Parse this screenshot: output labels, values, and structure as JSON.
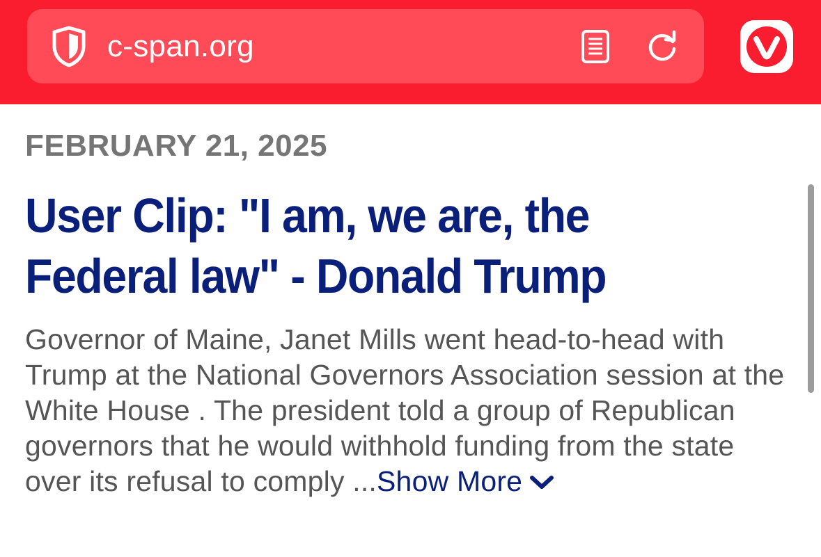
{
  "browser": {
    "url": "c-span.org",
    "accent_color": "#fa1c2f",
    "icons": [
      "shield-icon",
      "reader-mode-icon",
      "reload-icon",
      "vivaldi-logo"
    ]
  },
  "article": {
    "date": "FEBRUARY 21, 2025",
    "title": "User Clip: \"I am, we are, the Federal law\" - Donald Trump",
    "description": "Governor of Maine, Janet Mills went head-to-head with Trump at the National Governors Association session at the White House . The president told a group of Republican governors that he would withhold funding from the state over its refusal to comply ...",
    "show_more_label": "Show More",
    "title_color": "#0a1f7a"
  }
}
